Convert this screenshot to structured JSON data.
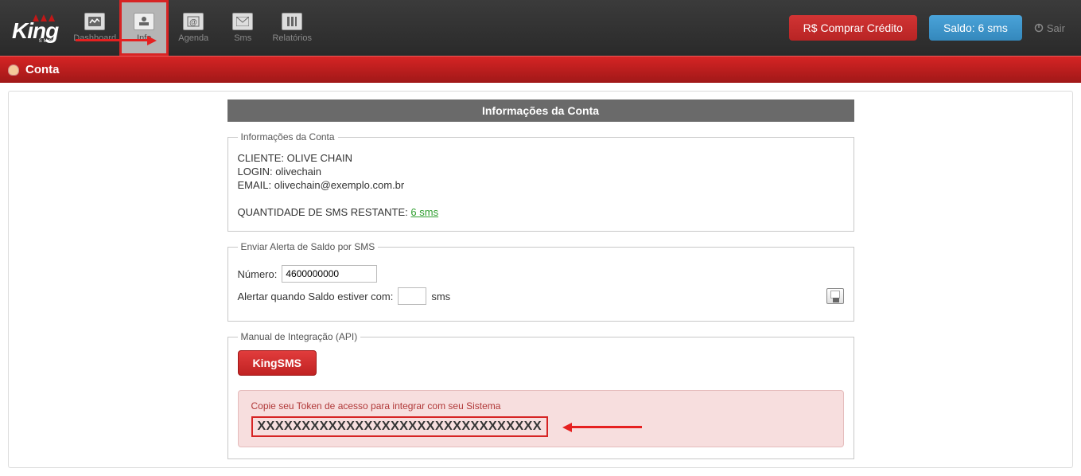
{
  "logo": {
    "text": "King",
    "sub": "SMS"
  },
  "nav": {
    "dashboard": "Dashboard",
    "info": "Info",
    "agenda": "Agenda",
    "sms": "Sms",
    "relatorios": "Relatórios"
  },
  "top_buttons": {
    "buy_credit": "R$ Comprar Crédito",
    "balance": "Saldo: 6 sms",
    "exit": "Sair"
  },
  "page_title": "Conta",
  "section_title": "Informações da Conta",
  "account": {
    "legend": "Informações da Conta",
    "cliente_label": "CLIENTE:",
    "cliente_value": "OLIVE CHAIN",
    "login_label": "LOGIN:",
    "login_value": "olivechain",
    "email_label": "EMAIL:",
    "email_value": "olivechain@exemplo.com.br",
    "sms_label": "QUANTIDADE DE SMS RESTANTE:",
    "sms_value": "6 sms"
  },
  "alert": {
    "legend": "Enviar Alerta de Saldo por SMS",
    "numero_label": "Número:",
    "numero_value": "4600000000",
    "threshold_label": "Alertar quando Saldo estiver com:",
    "threshold_value": "",
    "threshold_unit": "sms"
  },
  "api": {
    "legend": "Manual de Integração (API)",
    "button": "KingSMS",
    "token_msg": "Copie seu Token de acesso para integrar com seu Sistema",
    "token_value": "XXXXXXXXXXXXXXXXXXXXXXXXXXXXXXXX"
  }
}
